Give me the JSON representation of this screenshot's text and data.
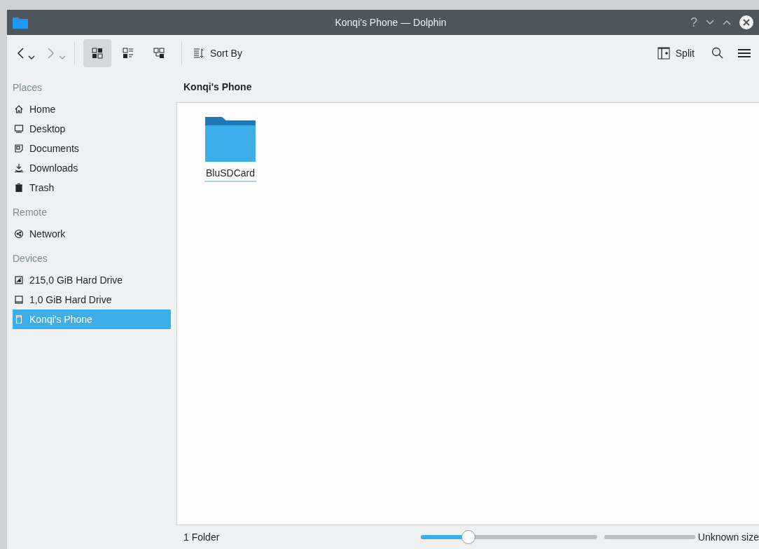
{
  "window": {
    "title": "Konqi's Phone — Dolphin",
    "controls": [
      "?"
    ]
  },
  "toolbar": {
    "view_modes": [
      {
        "kind": "icons",
        "selected": true
      },
      {
        "kind": "compact",
        "selected": false
      },
      {
        "kind": "tree",
        "selected": false
      }
    ],
    "sort_label": "Sort By",
    "split_label": "Split"
  },
  "sidebar": {
    "sections": [
      {
        "title": "Places",
        "items": [
          {
            "label": "Home",
            "kind": "home",
            "selected": false
          },
          {
            "label": "Desktop",
            "kind": "desktop",
            "selected": false
          },
          {
            "label": "Documents",
            "kind": "documents",
            "selected": false
          },
          {
            "label": "Downloads",
            "kind": "downloads",
            "selected": false
          },
          {
            "label": "Trash",
            "kind": "trash",
            "selected": false
          }
        ]
      },
      {
        "title": "Remote",
        "items": [
          {
            "label": "Network",
            "kind": "network",
            "selected": false
          }
        ]
      },
      {
        "title": "Devices",
        "items": [
          {
            "label": "215,0 GiB Hard Drive",
            "kind": "drive",
            "selected": false
          },
          {
            "label": "1,0 GiB Hard Drive",
            "kind": "drive2",
            "selected": false
          },
          {
            "label": "Konqi's Phone",
            "kind": "phone",
            "selected": true
          }
        ]
      }
    ]
  },
  "location": "Konqi's Phone",
  "files": [
    {
      "name": "BluSDCard",
      "selected": false
    }
  ],
  "status_bar": {
    "summary": "1 Folder",
    "zoom": {
      "level": 0.27
    },
    "space": "Unknown size"
  }
}
